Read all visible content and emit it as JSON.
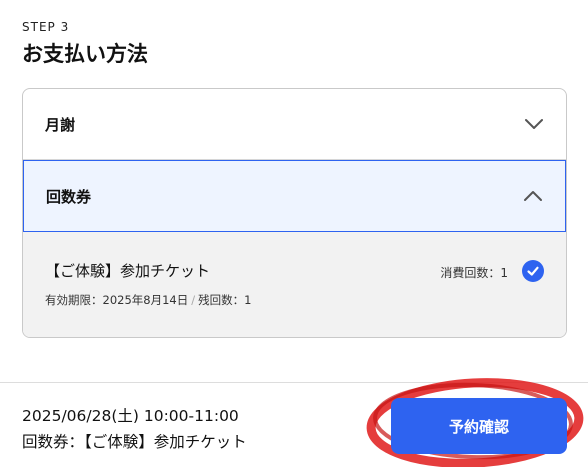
{
  "header": {
    "step": "STEP 3",
    "title": "お支払い方法"
  },
  "payment_options": {
    "monthly": {
      "label": "月謝",
      "expanded": false
    },
    "ticket": {
      "label": "回数券",
      "expanded": true,
      "item": {
        "name": "【ご体験】参加チケット",
        "expiry": "有効期限：2025年8月14日",
        "separator": "/",
        "remaining": "残回数：1",
        "usage": "消費回数：1",
        "selected": true
      }
    }
  },
  "summary": {
    "datetime": "2025/06/28(土) 10:00-11:00",
    "ticket": "回数券：【ご体験】参加チケット"
  },
  "actions": {
    "confirm_label": "予約確認"
  },
  "colors": {
    "accent": "#2e63f0",
    "selected_bg": "#eef4ff",
    "panel_bg": "#f2f2f2",
    "annotation": "#e01b1b"
  }
}
